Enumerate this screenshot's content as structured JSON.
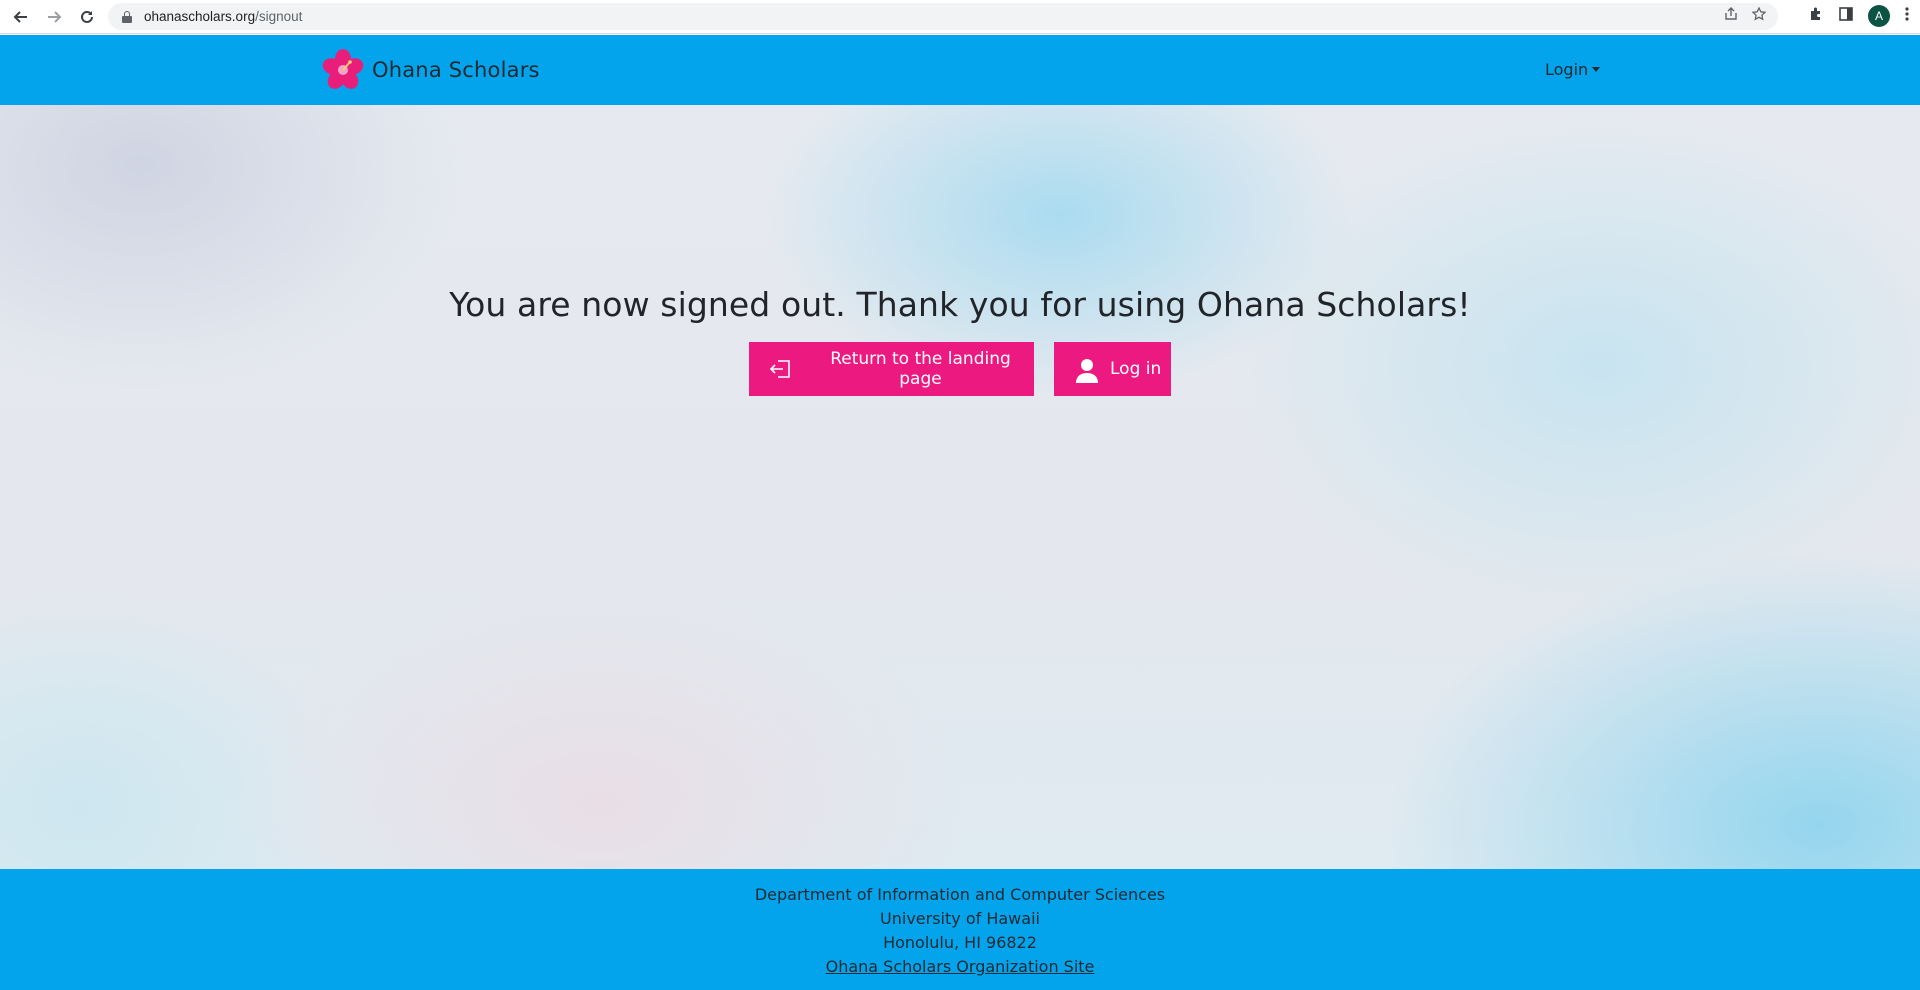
{
  "browser": {
    "url_host": "ohanascholars.org",
    "url_path": "/signout",
    "avatar_letter": "A",
    "icons": [
      "back-arrow-icon",
      "forward-arrow-icon",
      "reload-icon",
      "lock-icon",
      "share-icon",
      "star-icon",
      "extensions-icon",
      "sidepanel-icon",
      "menu-dots-icon"
    ]
  },
  "navbar": {
    "brand_name": "Ohana Scholars",
    "logo_icon": "hibiscus-flower-icon",
    "login_label": "Login",
    "background_color": "#03a4ec"
  },
  "main": {
    "title": "You are now signed out. Thank you for using Ohana Scholars!",
    "return_button_label": "Return to the landing page",
    "login_button_label": "Log in",
    "return_icon": "enter-door-icon",
    "login_icon": "person-icon",
    "button_color": "#ec1a80"
  },
  "footer": {
    "line1": "Department of Information and Computer Sciences",
    "line2": "University of Hawaii",
    "line3": "Honolulu, HI 96822",
    "link_label": "Ohana Scholars Organization Site"
  }
}
